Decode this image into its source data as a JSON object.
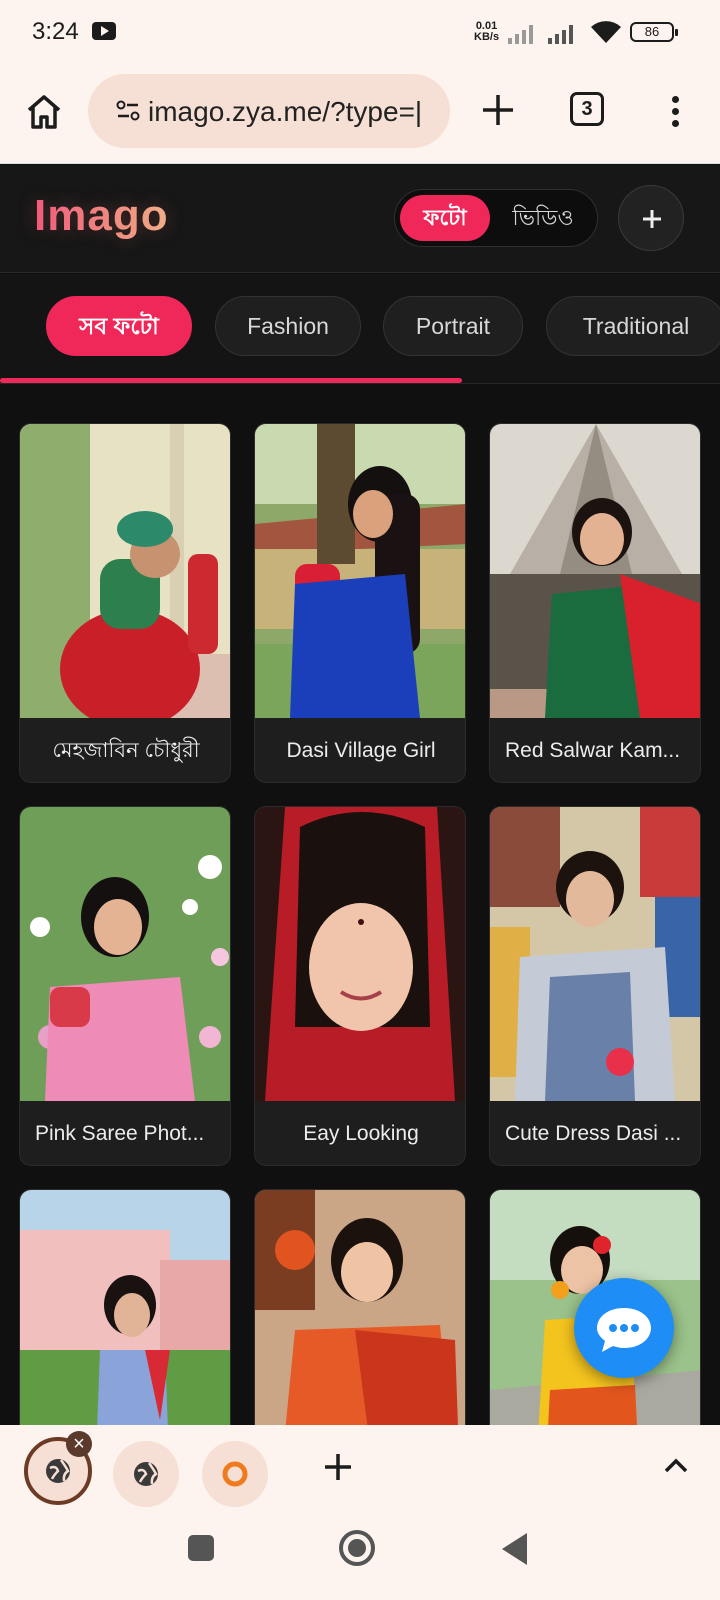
{
  "status_bar": {
    "time": "3:24",
    "net_speed_value": "0.01",
    "net_speed_unit": "KB/s",
    "battery": "86"
  },
  "browser": {
    "url": "imago.zya.me/?type=|",
    "tab_count": "3"
  },
  "app": {
    "logo": "Imago",
    "toggle": {
      "active": "ফটো",
      "inactive": "ভিডিও"
    }
  },
  "categories": [
    "সব ফটো",
    "Fashion",
    "Portrait",
    "Traditional"
  ],
  "cards": [
    {
      "title": "মেহজাবিন চৌধুরী"
    },
    {
      "title": "Dasi Village Girl"
    },
    {
      "title": "Red Salwar Kam..."
    },
    {
      "title": "Pink Saree Phot..."
    },
    {
      "title": "Eay Looking"
    },
    {
      "title": "Cute Dress Dasi ..."
    },
    {
      "title": ""
    },
    {
      "title": ""
    },
    {
      "title": ""
    }
  ],
  "colors": {
    "accent": "#f0285a",
    "chat_fab": "#1e8df5",
    "browser_chrome": "#fdf3ef",
    "app_bg": "#101010"
  },
  "icons": [
    "home-icon",
    "site-settings-icon",
    "plus-icon",
    "tabs-icon",
    "more-icon",
    "chat-icon",
    "globe-icon",
    "close-icon",
    "chevron-up-icon"
  ]
}
